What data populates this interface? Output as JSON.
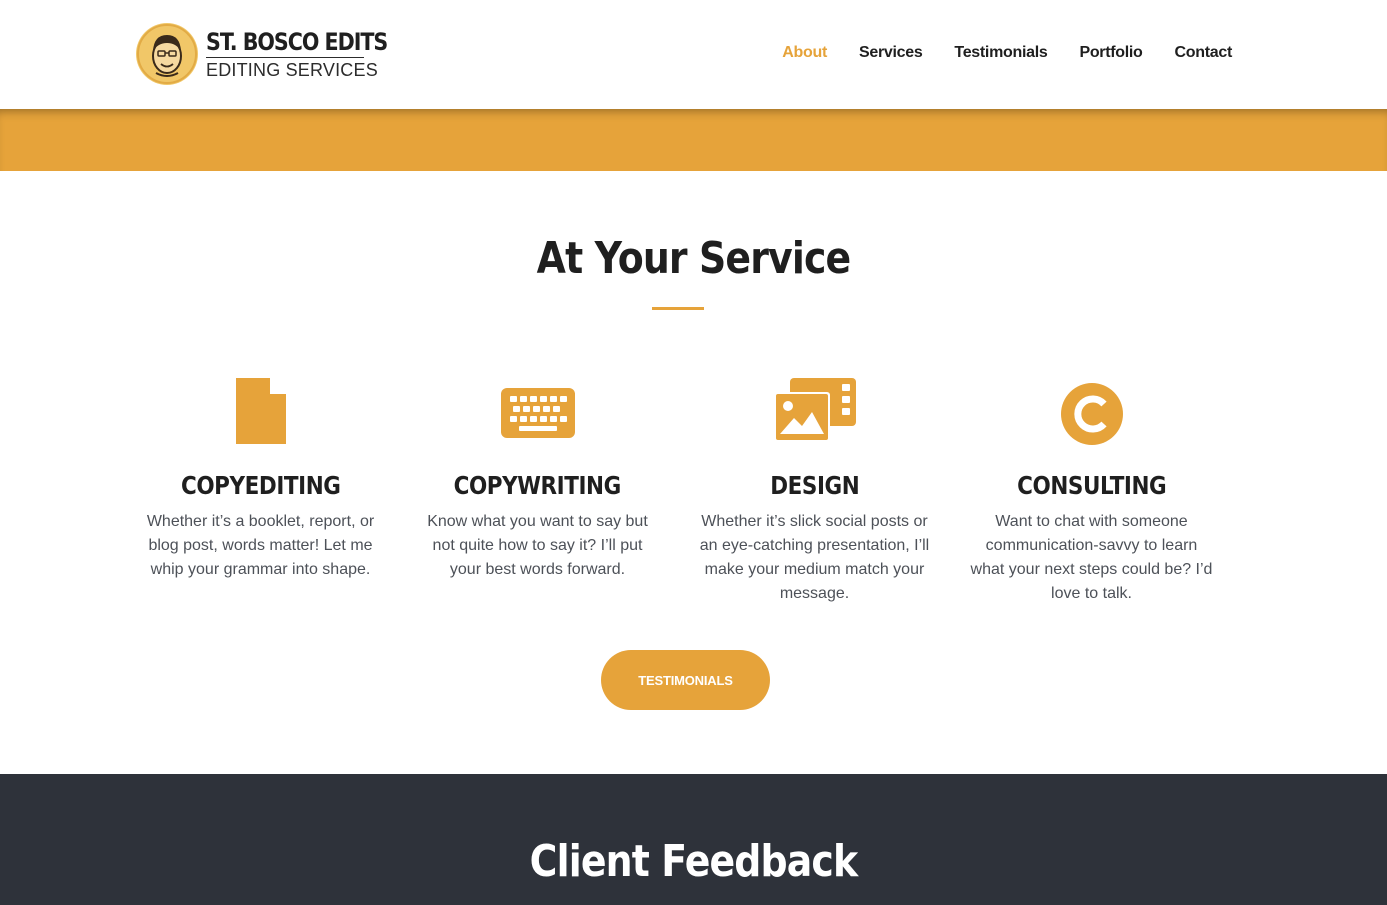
{
  "brand": {
    "title": "ST. BOSCO EDITS",
    "subtitle": "EDITING SERVICES",
    "logo_icon": "face-portrait-icon"
  },
  "nav": {
    "items": [
      {
        "label": "About",
        "active": true
      },
      {
        "label": "Services",
        "active": false
      },
      {
        "label": "Testimonials",
        "active": false
      },
      {
        "label": "Portfolio",
        "active": false
      },
      {
        "label": "Contact",
        "active": false
      }
    ]
  },
  "services_section": {
    "title": "At Your Service",
    "items": [
      {
        "icon": "document-icon",
        "name": "COPYEDITING",
        "description": "Whether it’s a booklet, report, or blog post, words matter! Let me whip your grammar into shape."
      },
      {
        "icon": "keyboard-icon",
        "name": "COPYWRITING",
        "description": "Know what you want to say but not quite how to say it? I’ll put your best words forward."
      },
      {
        "icon": "images-icon",
        "name": "DESIGN",
        "description": "Whether it’s slick social posts or an eye-catching presentation, I’ll make your medium match your message."
      },
      {
        "icon": "copyright-icon",
        "name": "CONSULTING",
        "description": "Want to chat with someone communication-savvy to learn what your next steps could be? I’d love to talk."
      }
    ],
    "button_label": "TESTIMONIALS"
  },
  "feedback_section": {
    "title": "Client Feedback"
  },
  "colors": {
    "accent": "#e6a33a",
    "dark_section": "#2e323a",
    "text_dark": "#1f1f1f",
    "text_body": "#4d5158"
  }
}
